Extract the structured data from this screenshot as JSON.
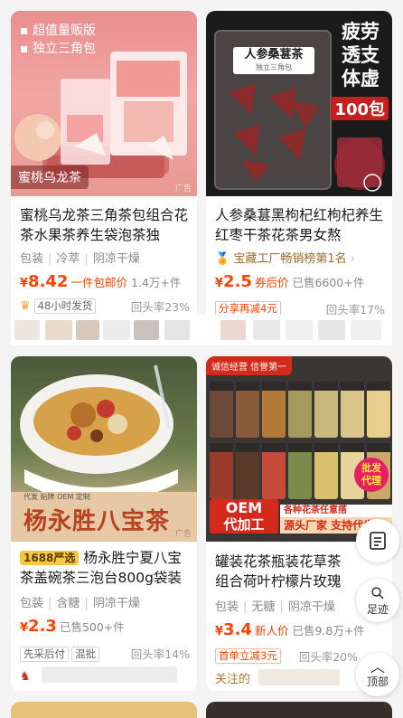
{
  "cards": [
    {
      "image_tag_lines": [
        "超值量贩版",
        "独立三角包"
      ],
      "image_label": "蜜桃乌龙茶",
      "ad_mark": "广告",
      "title": "蜜桃乌龙茶三角茶包组合花茶水果茶养生袋泡茶独",
      "tags": [
        "包装",
        "冷萃",
        "阴凉干燥"
      ],
      "currency": "¥",
      "price": "8.42",
      "promo": "一件包邮价",
      "sold": "1.4万+件",
      "badges": [
        "48小时发货"
      ],
      "repeat_rate": "回头率23%"
    },
    {
      "image_title": "人参桑葚茶",
      "image_sub": "独立三角包",
      "image_side": [
        "疲劳",
        "透支",
        "体虚"
      ],
      "image_count": "100包",
      "title": "人参桑葚黑枸杞红枸杞养生红枣干茶花茶男女熬",
      "rank": "宝藏工厂畅销榜第1名",
      "rank_arrow": "›",
      "currency": "¥",
      "price": "2.5",
      "promo": "券后价",
      "sold": "已售6600+件",
      "badges": [
        "分享再减4元"
      ],
      "repeat_rate": "回头率17%"
    },
    {
      "image_label": "杨永胜八宝茶",
      "ad_mark": "广告",
      "title_tag": "1688严选",
      "image_overlay": [
        "代发",
        "贴牌",
        "OEM",
        "定制"
      ],
      "title": "杨永胜宁夏八宝茶盖碗茶三泡台800g袋装",
      "tags": [
        "包装",
        "含糖",
        "阴凉干燥"
      ],
      "currency": "¥",
      "price": "2.3",
      "promo": "",
      "sold": "已售500+件",
      "badges": [
        "先采后付",
        "混批"
      ],
      "repeat_rate": "回头率14%"
    },
    {
      "image_top": "诚信经营 信誉第一",
      "image_oem": "OEM",
      "image_oem_sub": "代加工",
      "image_banner": "各种花茶任意搭",
      "image_banner2": "源头厂家 支持代发",
      "image_corner": [
        "批发",
        "代理"
      ],
      "title": "罐装花茶瓶装花草茶组合荷叶柠檬片玫瑰花金银花",
      "tags": [
        "包装",
        "无糖",
        "阴凉干燥"
      ],
      "currency": "¥",
      "price": "3.4",
      "promo": "新人价",
      "sold": "已售9.8万+件",
      "badges": [
        "首单立减3元"
      ],
      "repeat_rate": "回头率20%",
      "follow_text": "关注的"
    }
  ],
  "float_buttons": {
    "footprint_label": "足迹",
    "top_label": "顶部"
  },
  "colors": {
    "price": "#ff4400",
    "gray_text": "#8a8a8a",
    "background": "#f4f4f4"
  }
}
